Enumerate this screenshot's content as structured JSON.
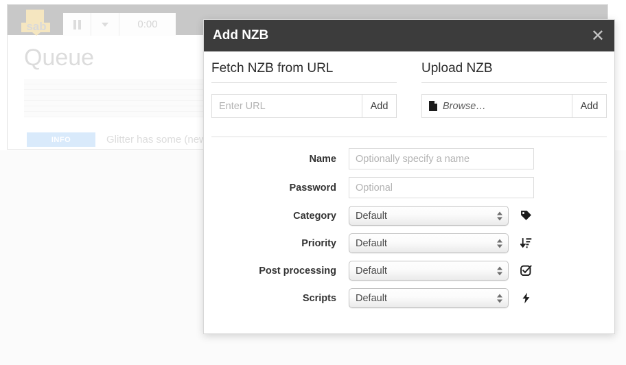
{
  "background": {
    "app_name": "sab",
    "toolbar": {
      "pause_label": "pause-icon",
      "dropdown_label": "caret-down-icon",
      "timer": "0:00"
    },
    "page_title": "Queue",
    "notice": {
      "badge": "INFO",
      "text": "Glitter has some (new) fea"
    }
  },
  "modal": {
    "title": "Add NZB",
    "close_label": "✕",
    "fetch_section": {
      "heading": "Fetch NZB from URL",
      "input_placeholder": "Enter URL",
      "input_value": "",
      "add_label": "Add"
    },
    "upload_section": {
      "heading": "Upload NZB",
      "browse_label": "Browse…",
      "add_label": "Add"
    },
    "form": {
      "rows": [
        {
          "label": "Name",
          "type": "text",
          "placeholder": "Optionally specify a name",
          "value": "",
          "icon": null
        },
        {
          "label": "Password",
          "type": "text",
          "placeholder": "Optional",
          "value": "",
          "icon": null
        },
        {
          "label": "Category",
          "type": "select",
          "value": "Default",
          "icon": "tag-icon"
        },
        {
          "label": "Priority",
          "type": "select",
          "value": "Default",
          "icon": "sort-amount-down-icon"
        },
        {
          "label": "Post processing",
          "type": "select",
          "value": "Default",
          "icon": "check-circle-icon"
        },
        {
          "label": "Scripts",
          "type": "select",
          "value": "Default",
          "icon": "bolt-icon"
        }
      ]
    }
  },
  "colors": {
    "modal_header_bg": "#3c3c3c",
    "topbar_bg": "#c8c8c8",
    "logo_paper": "#f5e6c0",
    "info_badge_bg": "#d9eafb"
  }
}
